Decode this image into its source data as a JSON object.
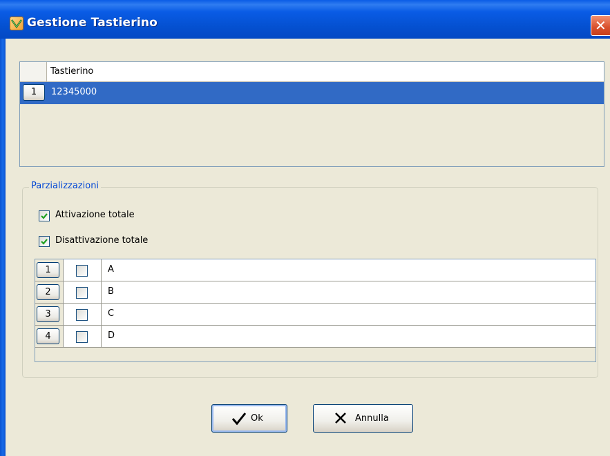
{
  "window": {
    "title": "Gestione Tastierino"
  },
  "keypad_table": {
    "column_header": "Tastierino",
    "rows": [
      {
        "index": "1",
        "value": "12345000"
      }
    ]
  },
  "partitions": {
    "legend": "Parzializzazioni",
    "total_activation": {
      "label": "Attivazione totale",
      "checked": true
    },
    "total_deactivation": {
      "label": "Disattivazione totale",
      "checked": true
    },
    "rows": [
      {
        "index": "1",
        "checked": false,
        "name": "A"
      },
      {
        "index": "2",
        "checked": false,
        "name": "B"
      },
      {
        "index": "3",
        "checked": false,
        "name": "C"
      },
      {
        "index": "4",
        "checked": false,
        "name": "D"
      }
    ]
  },
  "buttons": {
    "ok_label": "Ok",
    "cancel_label": "Annulla"
  },
  "colors": {
    "titlebar": "#0a5ce6",
    "selection": "#316ac5",
    "legend_text": "#0046d5",
    "close_button": "#d9502c"
  },
  "icons": {
    "app": "keypad-app-icon",
    "close": "close-icon",
    "ok": "checkmark-icon",
    "cancel": "x-icon"
  }
}
